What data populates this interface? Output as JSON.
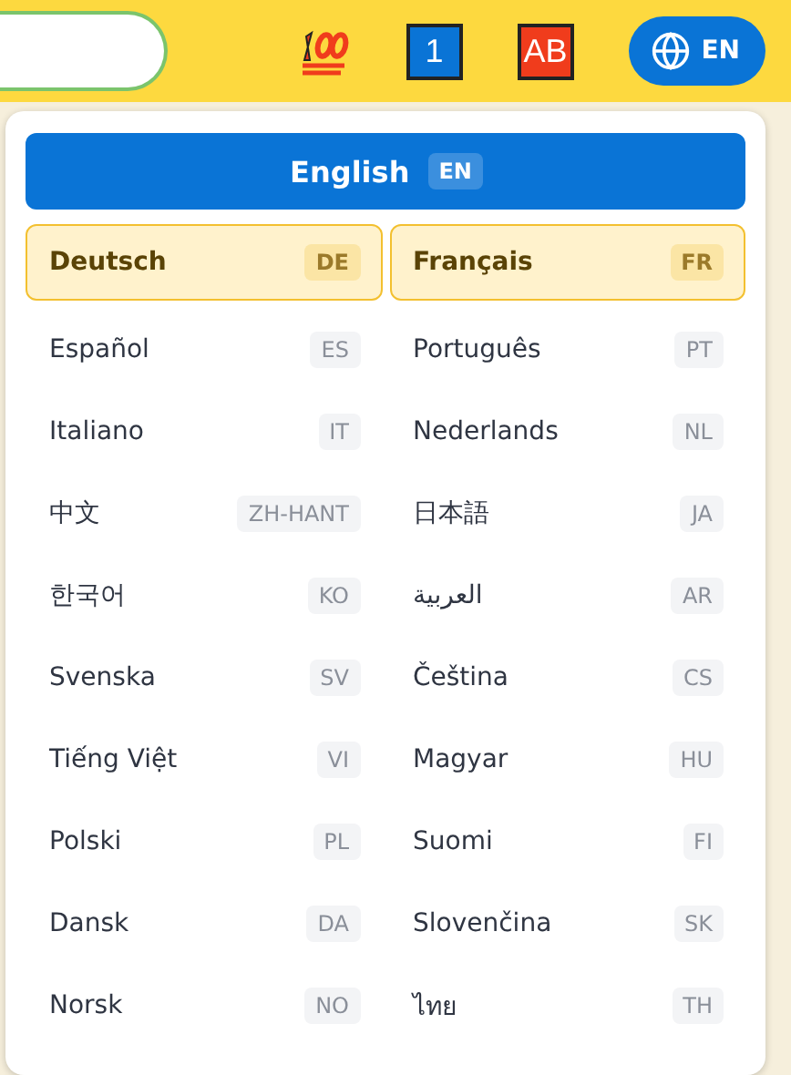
{
  "header": {
    "badges": [
      {
        "label": "1",
        "color": "#0a74d6"
      },
      {
        "label": "AB",
        "color": "#f03c1c"
      }
    ],
    "language_button": {
      "label": "EN"
    }
  },
  "language_menu": {
    "languages": [
      {
        "name": "English",
        "code": "EN",
        "kind": "primary",
        "selected": true
      },
      {
        "name": "Deutsch",
        "code": "DE",
        "kind": "featured",
        "selected": false
      },
      {
        "name": "Français",
        "code": "FR",
        "kind": "featured",
        "selected": false
      },
      {
        "name": "Español",
        "code": "ES",
        "kind": "plain",
        "selected": false
      },
      {
        "name": "Português",
        "code": "PT",
        "kind": "plain",
        "selected": false
      },
      {
        "name": "Italiano",
        "code": "IT",
        "kind": "plain",
        "selected": false
      },
      {
        "name": "Nederlands",
        "code": "NL",
        "kind": "plain",
        "selected": false
      },
      {
        "name": "中文",
        "code": "ZH-HANT",
        "kind": "plain",
        "selected": false
      },
      {
        "name": "日本語",
        "code": "JA",
        "kind": "plain",
        "selected": false
      },
      {
        "name": "한국어",
        "code": "KO",
        "kind": "plain",
        "selected": false
      },
      {
        "name": "العربية",
        "code": "AR",
        "kind": "plain",
        "selected": false
      },
      {
        "name": "Svenska",
        "code": "SV",
        "kind": "plain",
        "selected": false
      },
      {
        "name": "Čeština",
        "code": "CS",
        "kind": "plain",
        "selected": false
      },
      {
        "name": "Tiếng Việt",
        "code": "VI",
        "kind": "plain",
        "selected": false
      },
      {
        "name": "Magyar",
        "code": "HU",
        "kind": "plain",
        "selected": false
      },
      {
        "name": "Polski",
        "code": "PL",
        "kind": "plain",
        "selected": false
      },
      {
        "name": "Suomi",
        "code": "FI",
        "kind": "plain",
        "selected": false
      },
      {
        "name": "Dansk",
        "code": "DA",
        "kind": "plain",
        "selected": false
      },
      {
        "name": "Slovenčina",
        "code": "SK",
        "kind": "plain",
        "selected": false
      },
      {
        "name": "Norsk",
        "code": "NO",
        "kind": "plain",
        "selected": false
      },
      {
        "name": "ไทย",
        "code": "TH",
        "kind": "plain",
        "selected": false
      }
    ]
  }
}
